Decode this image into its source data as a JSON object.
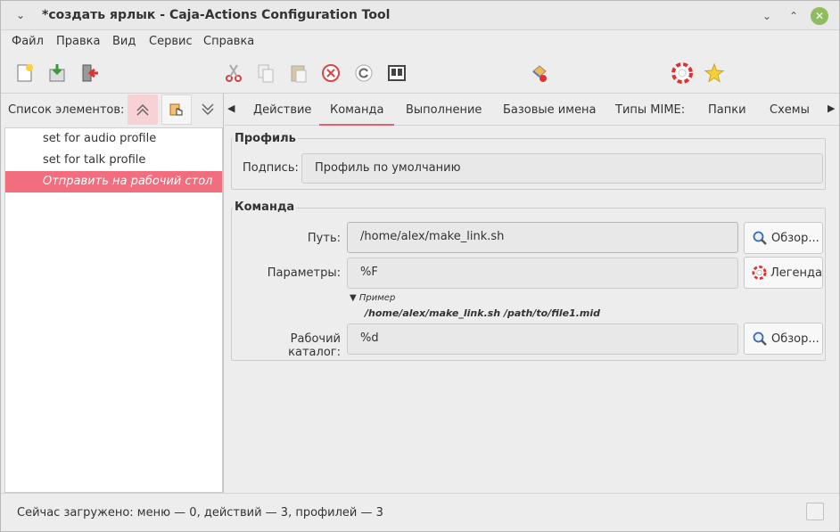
{
  "window": {
    "title": "*создать ярлык - Caja-Actions Configuration Tool"
  },
  "menubar": {
    "items": [
      "Файл",
      "Правка",
      "Вид",
      "Сервис",
      "Справка"
    ]
  },
  "toolbar": {
    "icons": [
      "new-document-icon",
      "save-icon",
      "quit-icon",
      "cut-icon",
      "copy-icon",
      "paste-icon",
      "delete-icon",
      "reload-icon",
      "export-icon",
      "import-icon",
      "help-icon",
      "about-icon"
    ]
  },
  "left": {
    "label": "Список элементов:",
    "items": [
      {
        "label": "set for audio profile",
        "selected": false
      },
      {
        "label": "set for talk profile",
        "selected": false
      },
      {
        "label": "Отправить на рабочий стол",
        "selected": true
      }
    ]
  },
  "tabs": {
    "items": [
      "Действие",
      "Команда",
      "Выполнение",
      "Базовые имена",
      "Типы MIME:",
      "Папки",
      "Схемы"
    ],
    "active": "Команда"
  },
  "profile": {
    "title": "Профиль",
    "caption_label": "Подпись:",
    "caption_value": "Профиль по умолчанию"
  },
  "command": {
    "title": "Команда",
    "path_label": "Путь:",
    "path_value": "/home/alex/make_link.sh",
    "browse_label": "Обзор...",
    "params_label": "Параметры:",
    "params_value": "%F",
    "legend_label": "Легенда",
    "example_label": "Пример",
    "example_value": "/home/alex/make_link.sh /path/to/file1.mid",
    "workdir_label": "Рабочий каталог:",
    "workdir_value": "%d",
    "browse2_label": "Обзор..."
  },
  "status": {
    "text": "Сейчас загружено: меню — 0, действий — 3, профилей — 3"
  },
  "colors": {
    "accent": "#f26d7d",
    "close_button": "#8fbc5c"
  }
}
